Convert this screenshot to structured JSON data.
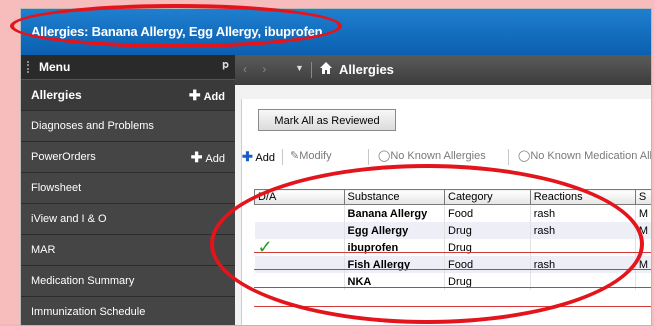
{
  "window": {
    "title": "Allergies: Banana Allergy, Egg Allergy, ibuprofen"
  },
  "sidebar": {
    "menu_label": "Menu",
    "pin_glyph": "ᵖ",
    "items": [
      {
        "label": "Allergies",
        "add_label": "Add",
        "active": true
      },
      {
        "label": "Diagnoses and Problems"
      },
      {
        "label": "PowerOrders",
        "add_label": "Add"
      },
      {
        "label": "Flowsheet"
      },
      {
        "label": "iView and I & O"
      },
      {
        "label": "MAR"
      },
      {
        "label": "Medication Summary"
      },
      {
        "label": "Immunization Schedule"
      }
    ]
  },
  "navbar": {
    "title": "Allergies"
  },
  "actions": {
    "mark_reviewed": "Mark All as Reviewed"
  },
  "toolbar": {
    "add": "Add",
    "modify": "Modify",
    "nka": "No Known Allergies",
    "nkma": "No Known Medication Aller"
  },
  "table": {
    "columns": [
      "D/A",
      "Substance",
      "Category",
      "Reactions",
      "S"
    ],
    "rows": [
      {
        "da": "",
        "substance": "Banana Allergy",
        "category": "Food",
        "reactions": "rash",
        "s": "M"
      },
      {
        "da": "",
        "substance": "Egg Allergy",
        "category": "Drug",
        "reactions": "rash",
        "s": "M"
      },
      {
        "da": "✓",
        "substance": "ibuprofen",
        "category": "Drug",
        "reactions": "",
        "s": ""
      },
      {
        "da": "",
        "substance": "Fish Allergy",
        "category": "Food",
        "reactions": "rash",
        "s": "M",
        "struck": true
      },
      {
        "da": "",
        "substance": "NKA",
        "category": "Drug",
        "reactions": "",
        "s": "",
        "struck": true
      }
    ]
  },
  "colors": {
    "annotation": "#e3141c",
    "titlebar": "#0b5fb0",
    "sidebar": "#3d3d3d",
    "check": "#2a9a2a",
    "strike": "#d23a3a"
  }
}
